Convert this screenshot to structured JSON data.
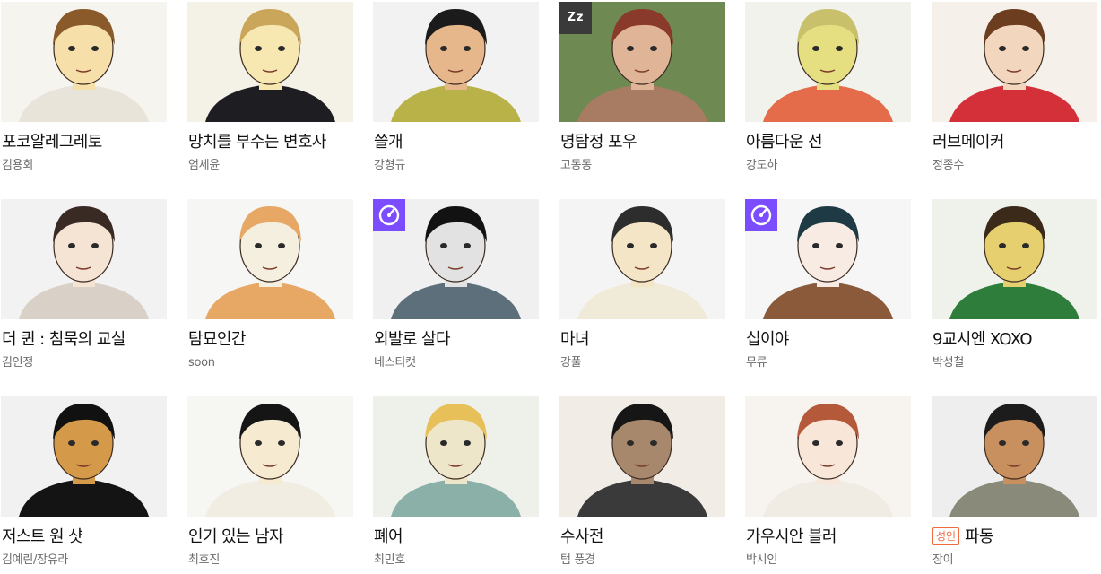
{
  "webtoons": [
    {
      "title": "포코알레그레토",
      "author": "김용회",
      "badge": null,
      "adult": false,
      "palette": {
        "bg": "#f6f4ee",
        "hair": "#8a5a2b",
        "skin": "#f6dfa8",
        "cloth": "#e9e4da"
      }
    },
    {
      "title": "망치를 부수는 변호사",
      "author": "엄세윤",
      "badge": null,
      "adult": false,
      "palette": {
        "bg": "#f4f1e6",
        "hair": "#c9a65a",
        "skin": "#f7e7b0",
        "cloth": "#1d1d22"
      }
    },
    {
      "title": "쓸개",
      "author": "강형규",
      "badge": null,
      "adult": false,
      "palette": {
        "bg": "#f2f2f2",
        "hair": "#1b1b1b",
        "skin": "#e6b78b",
        "cloth": "#b8b248"
      }
    },
    {
      "title": "명탐정 포우",
      "author": "고동동",
      "badge": "zz",
      "adult": false,
      "palette": {
        "bg": "#6e8a52",
        "hair": "#8a3a2a",
        "skin": "#e0b496",
        "cloth": "#a87c63"
      }
    },
    {
      "title": "아름다운 선",
      "author": "강도하",
      "badge": null,
      "adult": false,
      "palette": {
        "bg": "#f2f2ec",
        "hair": "#c8c06a",
        "skin": "#e5df82",
        "cloth": "#e56c4a"
      }
    },
    {
      "title": "러브메이커",
      "author": "정종수",
      "badge": null,
      "adult": false,
      "palette": {
        "bg": "#f5f1ea",
        "hair": "#6d3d20",
        "skin": "#f3d6be",
        "cloth": "#d3303a"
      }
    },
    {
      "title": "더 퀸 : 침묵의 교실",
      "author": "김인정",
      "badge": null,
      "adult": false,
      "palette": {
        "bg": "#f2f2f2",
        "hair": "#3a2a24",
        "skin": "#f5e3d3",
        "cloth": "#d9d0c8"
      }
    },
    {
      "title": "탐묘인간",
      "author": "soon",
      "badge": null,
      "adult": false,
      "palette": {
        "bg": "#f6f6f4",
        "hair": "#e6a864",
        "skin": "#f5efe0",
        "cloth": "#e6a864"
      }
    },
    {
      "title": "외발로 살다",
      "author": "네스티캣",
      "badge": "clock",
      "adult": false,
      "palette": {
        "bg": "#f0f0f0",
        "hair": "#121212",
        "skin": "#e2e2e2",
        "cloth": "#5c6f7a"
      }
    },
    {
      "title": "마녀",
      "author": "강풀",
      "badge": null,
      "adult": false,
      "palette": {
        "bg": "#f4f4f4",
        "hair": "#2d2d2d",
        "skin": "#f4e5c6",
        "cloth": "#f0ead8"
      }
    },
    {
      "title": "십이야",
      "author": "무류",
      "badge": "clock",
      "adult": false,
      "palette": {
        "bg": "#f6f6f6",
        "hair": "#1e3a44",
        "skin": "#f8ebe4",
        "cloth": "#8a5a3a"
      }
    },
    {
      "title": "9교시엔 XOXO",
      "author": "박성철",
      "badge": null,
      "adult": false,
      "palette": {
        "bg": "#eef2ea",
        "hair": "#3b2a1a",
        "skin": "#e6cf6e",
        "cloth": "#2e7d3a"
      }
    },
    {
      "title": "저스트 원 샷",
      "author": "김예린/장유라",
      "badge": null,
      "adult": false,
      "palette": {
        "bg": "#f1f1f1",
        "hair": "#111111",
        "skin": "#d49a4a",
        "cloth": "#141414"
      }
    },
    {
      "title": "인기 있는 남자",
      "author": "최호진",
      "badge": null,
      "adult": false,
      "palette": {
        "bg": "#f6f6f3",
        "hair": "#151515",
        "skin": "#f6ead0",
        "cloth": "#f2ede2"
      }
    },
    {
      "title": "폐어",
      "author": "최민호",
      "badge": null,
      "adult": false,
      "palette": {
        "bg": "#eef0ea",
        "hair": "#e8c05a",
        "skin": "#eee6c8",
        "cloth": "#8ab0a8"
      }
    },
    {
      "title": "수사전",
      "author": "텀 풍경",
      "badge": null,
      "adult": false,
      "palette": {
        "bg": "#f1ede6",
        "hair": "#161616",
        "skin": "#a8886c",
        "cloth": "#3a3a3a"
      }
    },
    {
      "title": "가우시안 블러",
      "author": "박시인",
      "badge": null,
      "adult": false,
      "palette": {
        "bg": "#f7f3ee",
        "hair": "#b45a3a",
        "skin": "#f8e6d8",
        "cloth": "#f0ece4"
      }
    },
    {
      "title": "파동",
      "author": "장이",
      "badge": null,
      "adult": true,
      "adult_label": "성인",
      "palette": {
        "bg": "#eeeeee",
        "hair": "#1c1c1c",
        "skin": "#c8905e",
        "cloth": "#8a8a7a"
      }
    }
  ],
  "badges": {
    "zz_label": "Zz"
  }
}
